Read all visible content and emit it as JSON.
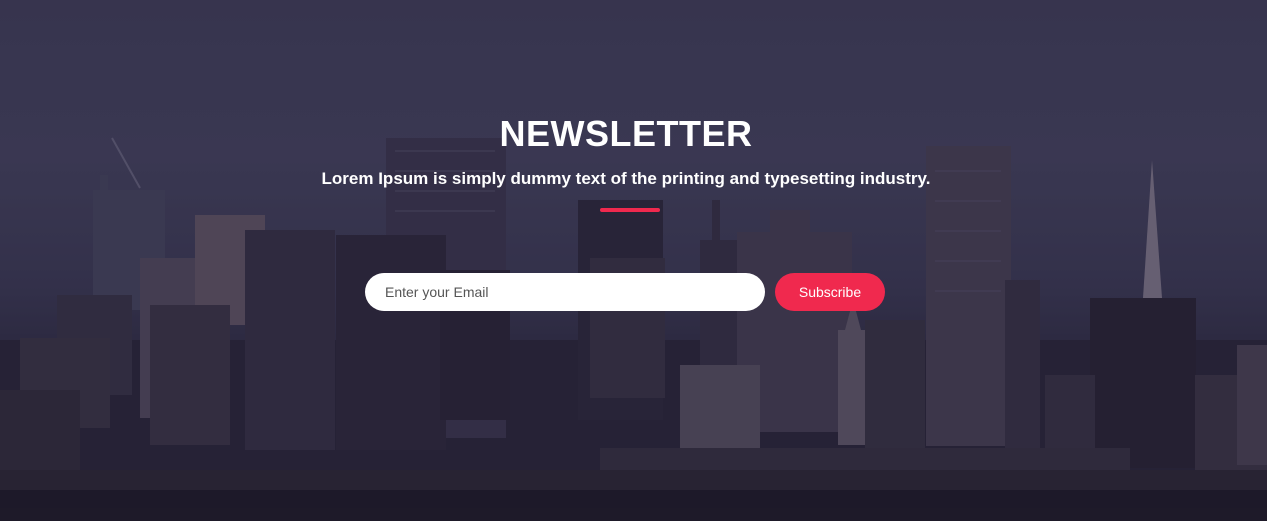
{
  "newsletter": {
    "title": "NEWSLETTER",
    "subtitle": "Lorem Ipsum is simply dummy text of the printing and typesetting industry.",
    "email_placeholder": "Enter your Email",
    "email_value": "",
    "subscribe_label": "Subscribe"
  },
  "colors": {
    "accent": "#f0294e",
    "text": "#ffffff",
    "sky": "#45435f",
    "buildings": "#2a2538"
  }
}
